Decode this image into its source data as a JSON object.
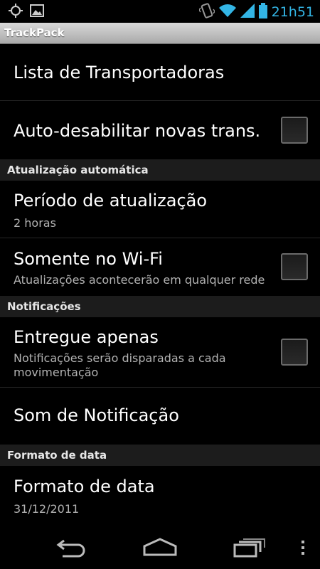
{
  "status_bar": {
    "time": "21h51",
    "left_icons": [
      "gps-icon",
      "image-icon"
    ],
    "right_icons": [
      "vibrate-icon",
      "wifi-icon",
      "signal-icon",
      "battery-icon"
    ],
    "accent_color": "#33b5e5"
  },
  "app": {
    "title": "TrackPack"
  },
  "preferences": {
    "carriers": {
      "title": "Lista de Transportadoras"
    },
    "auto_disable": {
      "title": "Auto-desabilitar novas trans.",
      "checked": false
    },
    "auto_update_category": "Atualização automática",
    "update_period": {
      "title": "Período de atualização",
      "summary": "2 horas"
    },
    "wifi_only": {
      "title": "Somente no Wi-Fi",
      "summary": "Atualizações acontecerão em qualquer rede",
      "checked": false
    },
    "notifications_category": "Notificações",
    "delivered_only": {
      "title": "Entregue apenas",
      "summary": "Notificações serão disparadas a cada movimentação",
      "checked": false
    },
    "notification_sound": {
      "title": "Som de Notificação"
    },
    "date_format_category": "Formato de data",
    "date_format": {
      "title": "Formato de data",
      "summary": "31/12/2011"
    }
  },
  "nav_bar": {
    "buttons": [
      "back-icon",
      "home-icon",
      "recent-apps-icon",
      "menu-icon"
    ]
  }
}
